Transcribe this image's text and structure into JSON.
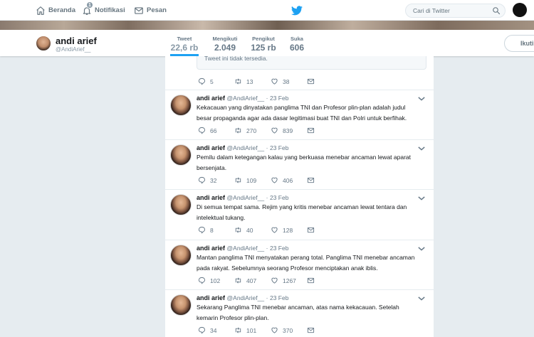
{
  "nav": {
    "home_label": "Beranda",
    "notifications_label": "Notifikasi",
    "notifications_count": "1",
    "messages_label": "Pesan",
    "search_placeholder": "Cari di Twitter",
    "icons": [
      "home-icon",
      "bell-icon",
      "envelope-icon",
      "twitter-bird-icon",
      "search-icon"
    ]
  },
  "profile": {
    "name": "andi arief",
    "handle": "@AndiArief__",
    "follow_label": "Ikuti",
    "stats": [
      {
        "label": "Tweet",
        "value": "22,6 rb"
      },
      {
        "label": "Mengikuti",
        "value": "2.049"
      },
      {
        "label": "Pengikut",
        "value": "125 rb"
      },
      {
        "label": "Suka",
        "value": "606"
      }
    ]
  },
  "timeline": {
    "unavailable_text": "Tweet ini tidak tersedia.",
    "top_actions": {
      "replies": "5",
      "retweets": "13",
      "likes": "38"
    },
    "tweets": [
      {
        "name": "andi arief",
        "handle": "@AndiArief__",
        "dot": "·",
        "date": "23 Feb",
        "text": "Kekacauan yang dinyatakan panglima TNI dan Profesor plin-plan adalah judul besar propaganda agar ada dasar  legitimasi buat TNI dan Polri untuk berfihak.",
        "replies": "66",
        "retweets": "270",
        "likes": "839"
      },
      {
        "name": "andi arief",
        "handle": "@AndiArief__",
        "dot": "·",
        "date": "23 Feb",
        "text": "Pemilu dalam ketegangan kalau yang berkuasa menebar ancaman lewat aparat bersenjata.",
        "replies": "32",
        "retweets": "109",
        "likes": "406"
      },
      {
        "name": "andi arief",
        "handle": "@AndiArief__",
        "dot": "·",
        "date": "23 Feb",
        "text": "Di semua tempat sama. Rejim yang kritis menebar ancaman lewat tentara dan intelektual tukang.",
        "replies": "8",
        "retweets": "40",
        "likes": "128"
      },
      {
        "name": "andi arief",
        "handle": "@AndiArief__",
        "dot": "·",
        "date": "23 Feb",
        "text": "Mantan panglima TNI menyatakan perang total. Panglima TNI menebar ancaman pada rakyat. Sebelumnya seorang  Profesor menciptakan anak iblis.",
        "replies": "102",
        "retweets": "407",
        "likes": "1267"
      },
      {
        "name": "andi arief",
        "handle": "@AndiArief__",
        "dot": "·",
        "date": "23 Feb",
        "text": "Sekarang Panglima TNI  menebar ancaman, atas nama kekacauan. Setelah kemarin Profesor plin-plan.",
        "replies": "34",
        "retweets": "101",
        "likes": "370"
      }
    ]
  },
  "colors": {
    "accent": "#1da1f2",
    "background": "#e6ecf0",
    "muted": "#657786"
  }
}
